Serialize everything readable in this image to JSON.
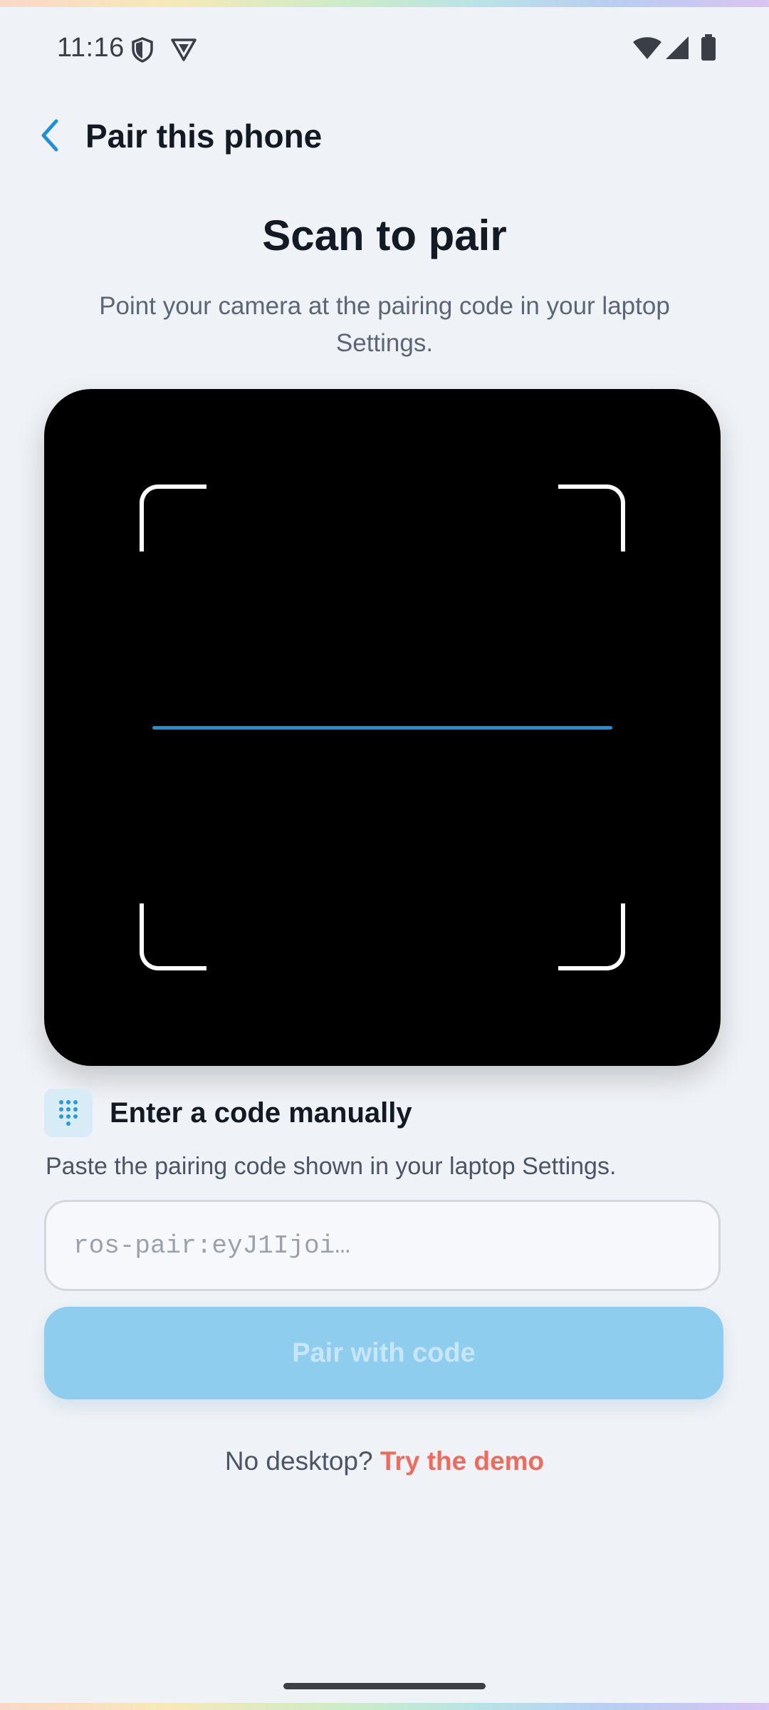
{
  "status_bar": {
    "time": "11:16"
  },
  "header": {
    "title": "Pair this phone"
  },
  "scan": {
    "title": "Scan to pair",
    "subtitle": "Point your camera at the pairing code in your laptop Settings."
  },
  "manual": {
    "title": "Enter a code manually",
    "hint": "Paste the pairing code shown in your laptop Settings.",
    "input_placeholder": "ros-pair:eyJ1Ijoi…",
    "input_value": "",
    "button_label": "Pair with code"
  },
  "footer": {
    "question": "No desktop?",
    "demo_link": "Try the demo"
  },
  "colors": {
    "accent": "#1f8fd6",
    "button_disabled": "#8ecdee",
    "demo_link": "#ef6b5b",
    "background": "#eff2f6"
  },
  "icons": [
    "shield-icon",
    "vpn-icon",
    "wifi-icon",
    "signal-icon",
    "battery-icon",
    "back-arrow-icon",
    "keypad-icon"
  ]
}
